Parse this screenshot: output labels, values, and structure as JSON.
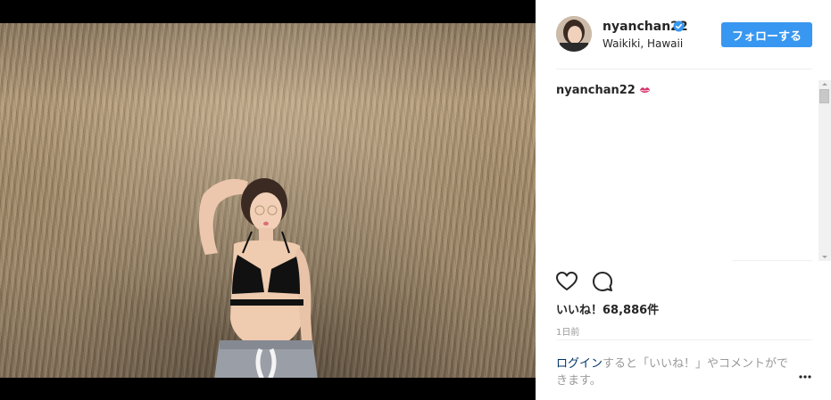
{
  "post": {
    "username": "nyanchan22",
    "location": "Waikiki, Hawaii",
    "follow_label": "フォローする",
    "caption_username": "nyanchan22",
    "likes_text": "いいね！68,886件",
    "time": "1日前",
    "login_link": "ログイン",
    "login_rest": "すると「いいね！」やコメントができます。"
  },
  "icons": {
    "verified": "verified-badge-icon",
    "caption_emoji": "kiss-mark-icon",
    "like": "heart-icon",
    "comment": "comment-bubble-icon",
    "more": "more-options-icon"
  },
  "colors": {
    "accent": "#3897f0",
    "link": "#003569",
    "muted": "#999999",
    "text": "#262626"
  }
}
